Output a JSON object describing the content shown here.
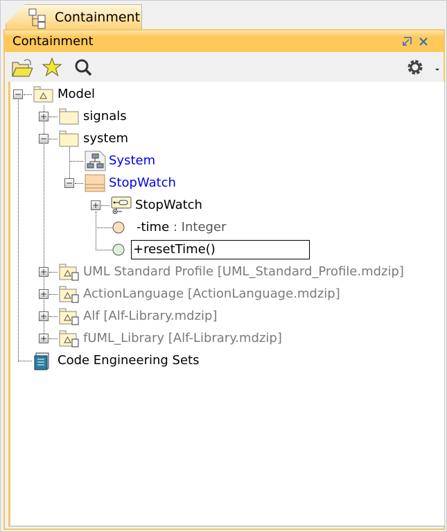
{
  "tab": {
    "label": "Containment"
  },
  "panel": {
    "title": "Containment"
  },
  "toolbar": {
    "icons": [
      "open-folder-icon",
      "star-icon",
      "search-icon",
      "gear-icon"
    ]
  },
  "tree": [
    {
      "label": "Model",
      "type": "model",
      "expanded": true
    },
    {
      "label": "signals",
      "type": "package",
      "expanded": false
    },
    {
      "label": "system",
      "type": "package",
      "expanded": true
    },
    {
      "label": "System",
      "type": "diagram"
    },
    {
      "label": "StopWatch",
      "type": "class",
      "expanded": true
    },
    {
      "label": "StopWatch",
      "type": "state-machine",
      "expanded": false
    },
    {
      "label": "-time",
      "type_label": " : Integer",
      "type": "property"
    },
    {
      "label": "+resetTime()",
      "type": "operation",
      "editing": true
    },
    {
      "label": "UML Standard Profile [UML_Standard_Profile.mdzip]",
      "type": "used-project"
    },
    {
      "label": "ActionLanguage [ActionLanguage.mdzip]",
      "type": "used-project"
    },
    {
      "label": "Alf [Alf-Library.mdzip]",
      "type": "used-project"
    },
    {
      "label": "fUML_Library [Alf-Library.mdzip]",
      "type": "used-project"
    },
    {
      "label": "Code Engineering Sets",
      "type": "code-sets"
    }
  ]
}
